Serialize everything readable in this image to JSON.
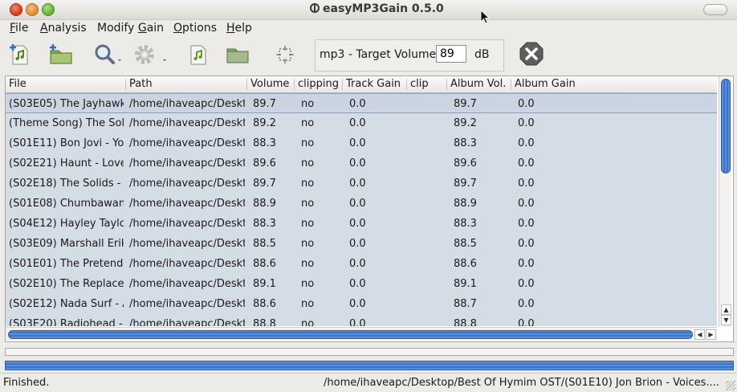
{
  "window": {
    "title": "easyMP3Gain 0.5.0"
  },
  "menu": [
    {
      "label": "File",
      "underline": "F",
      "rest": "ile"
    },
    {
      "label": "Analysis",
      "underline": "A",
      "rest": "nalysis"
    },
    {
      "label": "Modify Gain",
      "pre": "Modify ",
      "underline": "G",
      "rest": "ain"
    },
    {
      "label": "Options",
      "underline": "O",
      "rest": "ptions"
    },
    {
      "label": "Help",
      "underline": "H",
      "rest": "elp"
    }
  ],
  "toolbar": {
    "target_label": "mp3 - Target Volume:",
    "target_value": "89",
    "target_unit": "dB",
    "icons": [
      "add-file-icon",
      "add-folder-icon",
      "analyze-icon",
      "modify-gain-icon",
      "clear-file-icon",
      "clear-folder-icon",
      "select-icon",
      "stop-icon"
    ]
  },
  "table": {
    "columns": [
      "File",
      "Path",
      "Volume",
      "clipping",
      "Track Gain",
      "clip",
      "Album Vol.",
      "Album Gain"
    ],
    "rows": [
      {
        "file": "(S03E05) The Jayhawk",
        "path": "/home/ihaveapc/Deskt",
        "volume": "89.7",
        "clipping": "no",
        "track_gain": "0.0",
        "clip": "",
        "album_vol": "89.7",
        "album_gain": "0.0"
      },
      {
        "file": "(Theme Song) The Sol",
        "path": "/home/ihaveapc/Deskt",
        "volume": "89.2",
        "clipping": "no",
        "track_gain": "0.0",
        "clip": "",
        "album_vol": "89.2",
        "album_gain": "0.0"
      },
      {
        "file": "(S01E11) Bon Jovi - Yo",
        "path": "/home/ihaveapc/Deskt",
        "volume": "88.3",
        "clipping": "no",
        "track_gain": "0.0",
        "clip": "",
        "album_vol": "88.3",
        "album_gain": "0.0"
      },
      {
        "file": "(S02E21) Haunt - Love",
        "path": "/home/ihaveapc/Deskt",
        "volume": "89.6",
        "clipping": "no",
        "track_gain": "0.0",
        "clip": "",
        "album_vol": "89.6",
        "album_gain": "0.0"
      },
      {
        "file": "(S02E18) The Solids -",
        "path": "/home/ihaveapc/Deskt",
        "volume": "89.7",
        "clipping": "no",
        "track_gain": "0.0",
        "clip": "",
        "album_vol": "89.7",
        "album_gain": "0.0"
      },
      {
        "file": "(S01E08) Chumbawan",
        "path": "/home/ihaveapc/Deskt",
        "volume": "88.9",
        "clipping": "no",
        "track_gain": "0.0",
        "clip": "",
        "album_vol": "88.9",
        "album_gain": "0.0"
      },
      {
        "file": "(S04E12) Hayley Taylc",
        "path": "/home/ihaveapc/Deskt",
        "volume": "88.3",
        "clipping": "no",
        "track_gain": "0.0",
        "clip": "",
        "album_vol": "88.3",
        "album_gain": "0.0"
      },
      {
        "file": "(S03E09) Marshall Erik",
        "path": "/home/ihaveapc/Deskt",
        "volume": "88.5",
        "clipping": "no",
        "track_gain": "0.0",
        "clip": "",
        "album_vol": "88.5",
        "album_gain": "0.0"
      },
      {
        "file": "(S01E01) The Pretende",
        "path": "/home/ihaveapc/Deskt",
        "volume": "88.6",
        "clipping": "no",
        "track_gain": "0.0",
        "clip": "",
        "album_vol": "88.6",
        "album_gain": "0.0"
      },
      {
        "file": "(S02E10) The Replacei",
        "path": "/home/ihaveapc/Deskt",
        "volume": "89.1",
        "clipping": "no",
        "track_gain": "0.0",
        "clip": "",
        "album_vol": "89.1",
        "album_gain": "0.0"
      },
      {
        "file": "(S02E12) Nada Surf - A",
        "path": "/home/ihaveapc/Deskt",
        "volume": "88.6",
        "clipping": "no",
        "track_gain": "0.0",
        "clip": "",
        "album_vol": "88.7",
        "album_gain": "0.0"
      },
      {
        "file": "(S03E20) Radiohead -",
        "path": "/home/ihaveapc/Deskt",
        "volume": "88.8",
        "clipping": "no",
        "track_gain": "0.0",
        "clip": "",
        "album_vol": "88.8",
        "album_gain": "0.0"
      }
    ]
  },
  "status": {
    "left": "Finished.",
    "right": "/home/ihaveapc/Desktop/Best Of Hymim OST/(S01E10) Jon Brion - Voices...."
  },
  "progress": {
    "file_fraction": 0.0,
    "total_fraction": 1.0
  },
  "colors": {
    "row_bg": "#d4dce6",
    "accent": "#3d74c6",
    "stop": "#6b6b6b"
  }
}
